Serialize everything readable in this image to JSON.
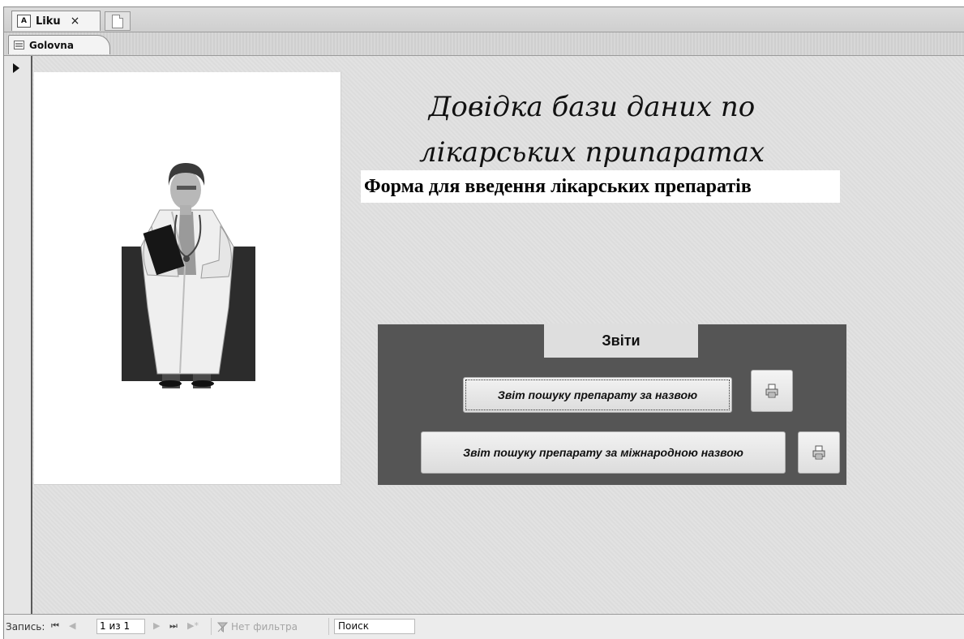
{
  "tabs": {
    "active_tab": "Liku",
    "close_symbol": "×"
  },
  "form_tab": {
    "label": "Golovna"
  },
  "form": {
    "title_line1": "Довідка бази даних по",
    "title_line2": "лікарських припаратах",
    "subtitle": "Форма для введення лікарських препаратів",
    "reports": {
      "header": "Звіти",
      "button1_label": "Звіт пошуку препарату за назвою",
      "button2_label": "Звіт пошуку препарату за міжнародною назвою"
    }
  },
  "navigation": {
    "label": "Запись:",
    "first_symbol": "⏮",
    "prev_symbol": "◀",
    "current": "1 из 1",
    "next_symbol": "▶",
    "last_symbol": "⏭",
    "new_symbol": "▶*",
    "filter_label": "Нет фильтра",
    "search_placeholder": "Поиск"
  },
  "icons": {
    "doctor_image": "doctor-illustration",
    "print_icon": "printer-icon"
  }
}
